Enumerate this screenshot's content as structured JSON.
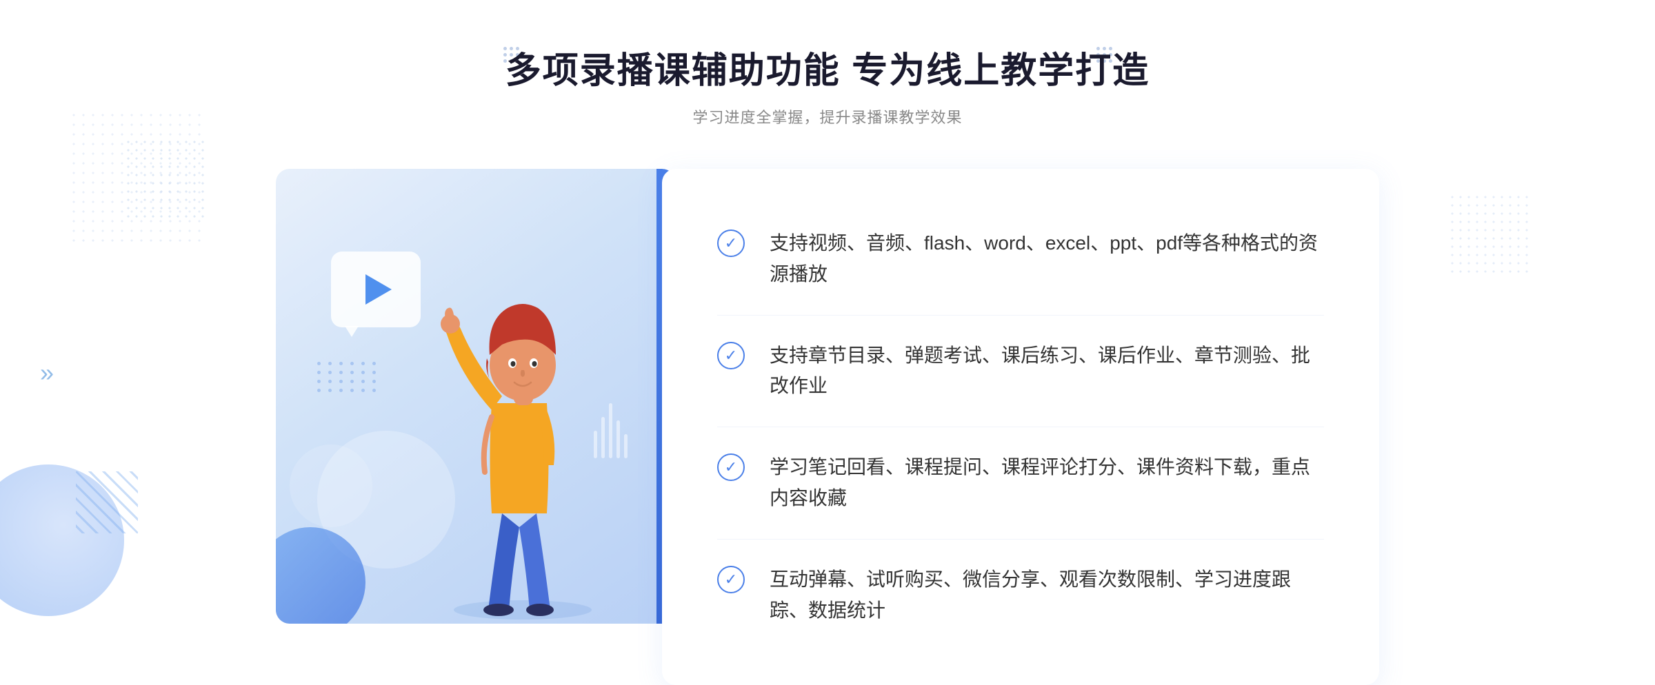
{
  "header": {
    "title": "多项录播课辅助功能 专为线上教学打造",
    "subtitle": "学习进度全掌握，提升录播课教学效果"
  },
  "features": [
    {
      "id": "feature-1",
      "text": "支持视频、音频、flash、word、excel、ppt、pdf等各种格式的资源播放"
    },
    {
      "id": "feature-2",
      "text": "支持章节目录、弹题考试、课后练习、课后作业、章节测验、批改作业"
    },
    {
      "id": "feature-3",
      "text": "学习笔记回看、课程提问、课程评论打分、课件资料下载，重点内容收藏"
    },
    {
      "id": "feature-4",
      "text": "互动弹幕、试听购买、微信分享、观看次数限制、学习进度跟踪、数据统计"
    }
  ],
  "decorations": {
    "chevron_left": "»",
    "play_button": "▶"
  }
}
